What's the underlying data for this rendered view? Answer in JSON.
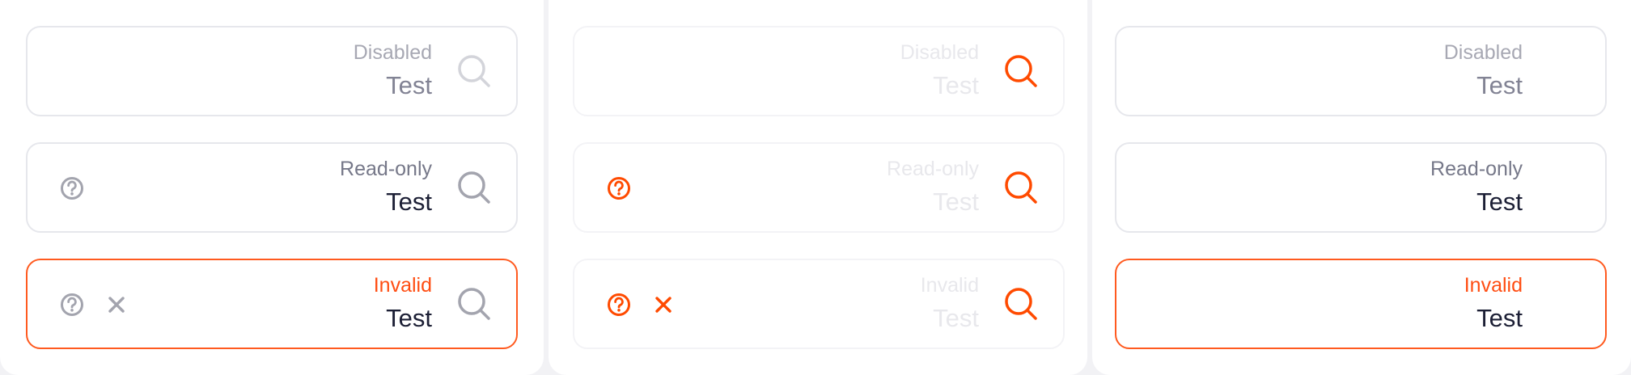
{
  "colors": {
    "invalid_accent": "#ff4d12",
    "icon_orange": "#ff4a00",
    "icon_gray": "#a3a4ae",
    "border": "#e6e7ec"
  },
  "columns": [
    {
      "variant": "default",
      "fields": [
        {
          "state": "disabled",
          "label": "Disabled",
          "value": "Test",
          "icons": [
            "search-icon"
          ]
        },
        {
          "state": "read-only",
          "label": "Read-only",
          "value": "Test",
          "icons": [
            "help-circle-icon",
            "search-icon"
          ]
        },
        {
          "state": "invalid",
          "label": "Invalid",
          "value": "Test",
          "icons": [
            "help-circle-icon",
            "clear-x-icon",
            "search-icon"
          ]
        }
      ]
    },
    {
      "variant": "accent-icons",
      "fields": [
        {
          "state": "disabled",
          "label": "Disabled",
          "value": "Test",
          "icons": [
            "search-icon"
          ]
        },
        {
          "state": "read-only",
          "label": "Read-only",
          "value": "Test",
          "icons": [
            "help-circle-icon",
            "search-icon"
          ]
        },
        {
          "state": "invalid",
          "label": "Invalid",
          "value": "Test",
          "icons": [
            "help-circle-icon",
            "clear-x-icon",
            "search-icon"
          ]
        }
      ]
    },
    {
      "variant": "no-icons",
      "fields": [
        {
          "state": "disabled",
          "label": "Disabled",
          "value": "Test",
          "icons": []
        },
        {
          "state": "read-only",
          "label": "Read-only",
          "value": "Test",
          "icons": []
        },
        {
          "state": "invalid",
          "label": "Invalid",
          "value": "Test",
          "icons": []
        }
      ]
    }
  ]
}
